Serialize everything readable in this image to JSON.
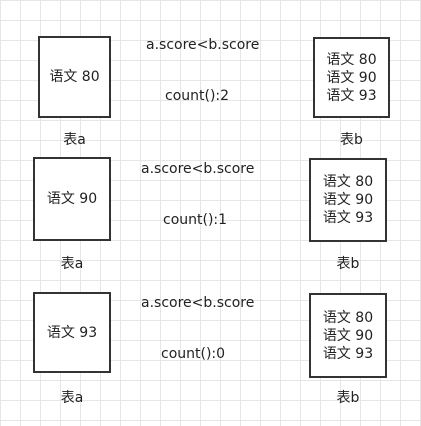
{
  "rows": [
    {
      "a_value": "语文 80",
      "a_label": "表a",
      "condition": "a.score<b.score",
      "count": "count():2",
      "b_values": [
        "语文 80",
        "语文 90",
        "语文 93"
      ],
      "b_label": "表b"
    },
    {
      "a_value": "语文 90",
      "a_label": "表a",
      "condition": "a.score<b.score",
      "count": "count():1",
      "b_values": [
        "语文 80",
        "语文 90",
        "语文 93"
      ],
      "b_label": "表b"
    },
    {
      "a_value": "语文 93",
      "a_label": "表a",
      "condition": "a.score<b.score",
      "count": "count():0",
      "b_values": [
        "语文 80",
        "语文 90",
        "语文 93"
      ],
      "b_label": "表b"
    }
  ]
}
